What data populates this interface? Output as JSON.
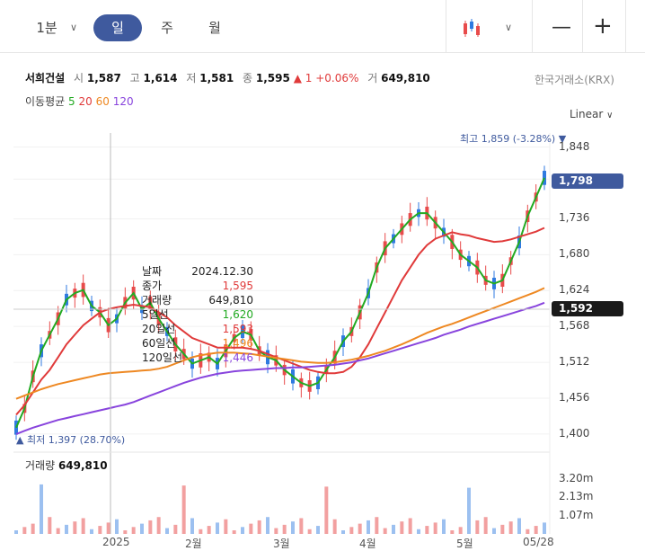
{
  "intervals": [
    {
      "label": "1분",
      "selected": false
    },
    {
      "label": "일",
      "selected": true
    },
    {
      "label": "주",
      "selected": false
    },
    {
      "label": "월",
      "selected": false
    }
  ],
  "stock": {
    "name": "서희건설",
    "open_label": "시",
    "open": "1,587",
    "high_label": "고",
    "high": "1,614",
    "low_label": "저",
    "low": "1,581",
    "close_label": "종",
    "close": "1,595",
    "change_arrow": "▲",
    "change": "1",
    "change_pct": "+0.06%",
    "volume_label": "거",
    "volume": "649,810",
    "exchange": "한국거래소(KRX)"
  },
  "moving_avg": {
    "label": "이동평균",
    "periods": [
      {
        "value": "5",
        "color": "#22aa22"
      },
      {
        "value": "20",
        "color": "#e03a3a"
      },
      {
        "value": "60",
        "color": "#ee8822"
      },
      {
        "value": "120",
        "color": "#8844dd"
      }
    ]
  },
  "scale_mode": "Linear",
  "tooltip": {
    "rows": [
      {
        "key": "날짜",
        "value": "2024.12.30",
        "color": "#222"
      },
      {
        "key": "종가",
        "value": "1,595",
        "color": "#e03a3a"
      },
      {
        "key": "거래량",
        "value": "649,810",
        "color": "#222"
      },
      {
        "key": "5일선",
        "value": "1,620",
        "color": "#22aa22"
      },
      {
        "key": "20일선",
        "value": "1,593",
        "color": "#e03a3a"
      },
      {
        "key": "60일선",
        "value": "1,496",
        "color": "#ee8822"
      },
      {
        "key": "120일선",
        "value": "1,446",
        "color": "#8844dd"
      }
    ]
  },
  "annotations": {
    "high": "최고 1,859 (-3.28%) ▼",
    "low": "▲ 최저 1,397 (28.70%)"
  },
  "price_tags": {
    "last": "1,798",
    "crosshair": "1,592"
  },
  "volume_panel": {
    "title": "거래량",
    "value": "649,810",
    "ticks": [
      "3.20m",
      "2.13m",
      "1.07m"
    ]
  },
  "colors": {
    "up": "#e84b4b",
    "down": "#2f7ae0",
    "ma5": "#22aa22",
    "ma20": "#e03a3a",
    "ma60": "#ee8822",
    "ma120": "#8844dd",
    "accent": "#3f5a9e"
  },
  "chart_data": {
    "type": "candlestick",
    "y_ticks": [
      1848,
      1798,
      1736,
      1680,
      1624,
      1568,
      1512,
      1456,
      1400
    ],
    "ylim": [
      1390,
      1870
    ],
    "x_tick_labels": [
      "2025",
      "2월",
      "3월",
      "4월",
      "5월",
      "05/28"
    ],
    "volume_ticks_m": [
      3.2,
      2.13,
      1.07
    ],
    "series": [
      {
        "name": "5",
        "values": [
          1410,
          1440,
          1490,
          1530,
          1555,
          1580,
          1610,
          1620,
          1625,
          1600,
          1590,
          1570,
          1580,
          1605,
          1620,
          1595,
          1605,
          1580,
          1560,
          1540,
          1525,
          1510,
          1515,
          1520,
          1510,
          1530,
          1550,
          1560,
          1555,
          1530,
          1520,
          1515,
          1500,
          1490,
          1480,
          1475,
          1480,
          1500,
          1520,
          1545,
          1560,
          1590,
          1620,
          1660,
          1690,
          1705,
          1720,
          1735,
          1745,
          1745,
          1730,
          1715,
          1700,
          1680,
          1670,
          1660,
          1640,
          1635,
          1640,
          1670,
          1700,
          1740,
          1770,
          1800
        ]
      },
      {
        "name": "20",
        "values": [
          1430,
          1445,
          1465,
          1485,
          1500,
          1520,
          1540,
          1555,
          1570,
          1580,
          1590,
          1595,
          1598,
          1600,
          1602,
          1600,
          1598,
          1590,
          1582,
          1570,
          1560,
          1550,
          1545,
          1540,
          1535,
          1535,
          1535,
          1535,
          1533,
          1530,
          1525,
          1520,
          1515,
          1510,
          1505,
          1500,
          1497,
          1495,
          1495,
          1497,
          1505,
          1520,
          1540,
          1565,
          1590,
          1615,
          1640,
          1660,
          1680,
          1695,
          1705,
          1710,
          1715,
          1712,
          1710,
          1706,
          1703,
          1700,
          1701,
          1704,
          1708,
          1712,
          1716,
          1722
        ]
      },
      {
        "name": "60",
        "values": [
          1455,
          1460,
          1465,
          1470,
          1474,
          1478,
          1481,
          1484,
          1487,
          1490,
          1493,
          1495,
          1496,
          1497,
          1498,
          1499,
          1500,
          1502,
          1505,
          1510,
          1515,
          1520,
          1523,
          1525,
          1527,
          1527,
          1527,
          1526,
          1525,
          1523,
          1521,
          1519,
          1517,
          1515,
          1513,
          1512,
          1511,
          1511,
          1512,
          1514,
          1516,
          1519,
          1522,
          1526,
          1530,
          1535,
          1540,
          1546,
          1552,
          1558,
          1563,
          1568,
          1572,
          1577,
          1582,
          1587,
          1592,
          1597,
          1602,
          1607,
          1612,
          1617,
          1622,
          1628
        ]
      },
      {
        "name": "120",
        "values": [
          1400,
          1405,
          1410,
          1414,
          1418,
          1422,
          1425,
          1428,
          1431,
          1434,
          1437,
          1440,
          1443,
          1446,
          1450,
          1455,
          1460,
          1465,
          1470,
          1475,
          1480,
          1484,
          1488,
          1491,
          1494,
          1496,
          1498,
          1499,
          1500,
          1501,
          1502,
          1503,
          1503,
          1504,
          1504,
          1505,
          1506,
          1507,
          1508,
          1510,
          1512,
          1515,
          1518,
          1522,
          1526,
          1530,
          1534,
          1538,
          1542,
          1546,
          1550,
          1555,
          1559,
          1563,
          1568,
          1572,
          1576,
          1580,
          1584,
          1588,
          1592,
          1596,
          1600,
          1605
        ]
      }
    ]
  }
}
